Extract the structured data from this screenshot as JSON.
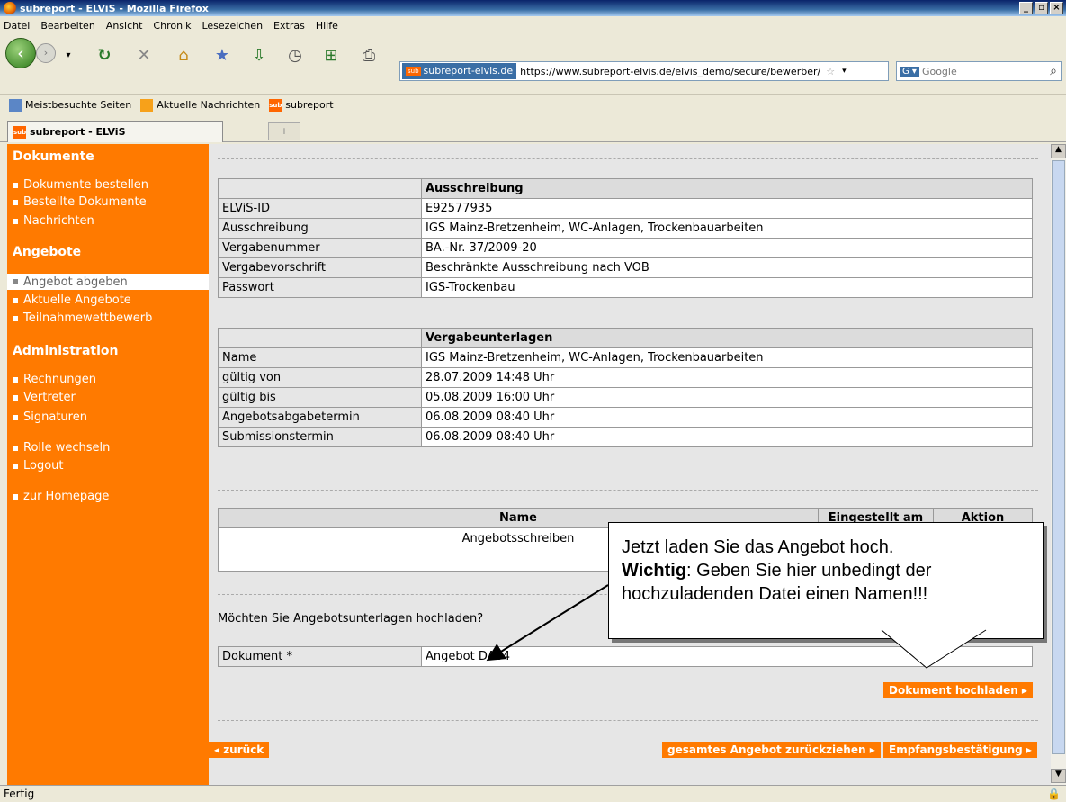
{
  "window": {
    "title": "subreport - ELViS - Mozilla Firefox"
  },
  "menu": [
    "Datei",
    "Bearbeiten",
    "Ansicht",
    "Chronik",
    "Lesezeichen",
    "Extras",
    "Hilfe"
  ],
  "addressbar": {
    "site": "subreport-elvis.de",
    "url": "https://www.subreport-elvis.de/elvis_demo/secure/bewerber/"
  },
  "search": {
    "placeholder": "Google"
  },
  "bookmarks": [
    "Meistbesuchte Seiten",
    "Aktuelle Nachrichten",
    "subreport"
  ],
  "tab": {
    "title": "subreport - ELViS",
    "new_tab": "+"
  },
  "sidebar": {
    "dokumente": {
      "heading": "Dokumente",
      "items": [
        "Dokumente bestellen",
        "Bestellte Dokumente",
        "Nachrichten"
      ]
    },
    "angebote": {
      "heading": "Angebote",
      "items": [
        "Angebot abgeben",
        "Aktuelle Angebote",
        "Teilnahmewettbewerb"
      ]
    },
    "administration": {
      "heading": "Administration",
      "items": [
        "Rechnungen",
        "Vertreter",
        "Signaturen"
      ]
    },
    "other": [
      "Rolle wechseln",
      "Logout",
      "zur Homepage"
    ]
  },
  "ausschreibung": {
    "header": "Ausschreibung",
    "rows": [
      [
        "ELViS-ID",
        "E92577935"
      ],
      [
        "Ausschreibung",
        "IGS Mainz-Bretzenheim, WC-Anlagen, Trockenbauarbeiten"
      ],
      [
        "Vergabenummer",
        "BA.-Nr. 37/2009-20"
      ],
      [
        "Vergabevorschrift",
        "Beschränkte Ausschreibung nach VOB"
      ],
      [
        "Passwort",
        "IGS-Trockenbau"
      ]
    ]
  },
  "vergabeunterlagen": {
    "header": "Vergabeunterlagen",
    "rows": [
      [
        "Name",
        "IGS Mainz-Bretzenheim, WC-Anlagen, Trockenbauarbeiten"
      ],
      [
        "gültig von",
        "28.07.2009 14:48 Uhr"
      ],
      [
        "gültig bis",
        "05.08.2009 16:00 Uhr"
      ],
      [
        "Angebotsabgabetermin",
        "06.08.2009 08:40 Uhr"
      ],
      [
        "Submissionstermin",
        "06.08.2009 08:40 Uhr"
      ]
    ]
  },
  "files": {
    "col_name": "Name",
    "col_date": "Eingestellt am",
    "col_action": "Aktion",
    "row_name": "Angebotsschreiben"
  },
  "upload": {
    "question": "Möchten Sie Angebotsunterlagen hochladen?",
    "label": "Dokument *",
    "value": "Angebot DA84",
    "button": "Dokument hochladen ▸"
  },
  "callout": {
    "line1": "Jetzt laden Sie das Angebot hoch.",
    "bold": "Wichtig",
    "line2": ": Geben Sie hier unbedingt der",
    "line3": "hochzuladenden Datei einen Namen!!!"
  },
  "footer_buttons": {
    "back": "◂ zurück",
    "withdraw": "gesamtes Angebot zurückziehen ▸",
    "receipt": "Empfangsbestätigung ▸"
  },
  "status": "Fertig"
}
